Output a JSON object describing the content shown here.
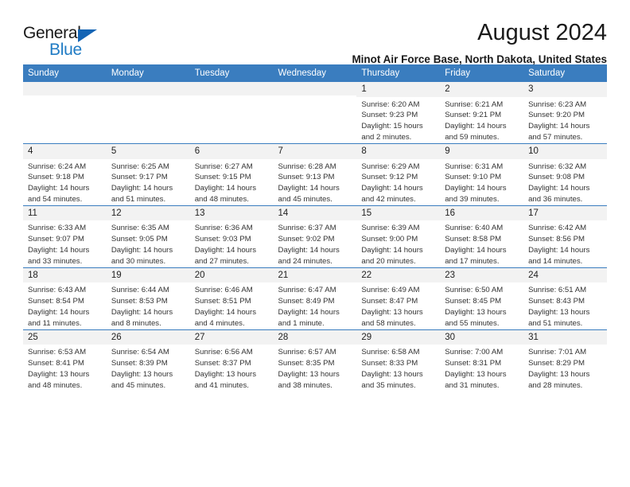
{
  "brand": {
    "line1": "General",
    "line2": "Blue",
    "triangle_color": "#1565b5",
    "blue_color": "#1f7bc4"
  },
  "header": {
    "title": "August 2024",
    "subtitle": "Minot Air Force Base, North Dakota, United States"
  },
  "theme": {
    "header_bg": "#3a7dbf",
    "daynum_bg": "#f2f2f2",
    "rule_color": "#3a7dbf"
  },
  "weekdays": [
    "Sunday",
    "Monday",
    "Tuesday",
    "Wednesday",
    "Thursday",
    "Friday",
    "Saturday"
  ],
  "weeks": [
    [
      {
        "day": "",
        "empty": true
      },
      {
        "day": "",
        "empty": true
      },
      {
        "day": "",
        "empty": true
      },
      {
        "day": "",
        "empty": true
      },
      {
        "day": "1",
        "sunrise": "Sunrise: 6:20 AM",
        "sunset": "Sunset: 9:23 PM",
        "daylight_1": "Daylight: 15 hours",
        "daylight_2": "and 2 minutes."
      },
      {
        "day": "2",
        "sunrise": "Sunrise: 6:21 AM",
        "sunset": "Sunset: 9:21 PM",
        "daylight_1": "Daylight: 14 hours",
        "daylight_2": "and 59 minutes."
      },
      {
        "day": "3",
        "sunrise": "Sunrise: 6:23 AM",
        "sunset": "Sunset: 9:20 PM",
        "daylight_1": "Daylight: 14 hours",
        "daylight_2": "and 57 minutes."
      }
    ],
    [
      {
        "day": "4",
        "sunrise": "Sunrise: 6:24 AM",
        "sunset": "Sunset: 9:18 PM",
        "daylight_1": "Daylight: 14 hours",
        "daylight_2": "and 54 minutes."
      },
      {
        "day": "5",
        "sunrise": "Sunrise: 6:25 AM",
        "sunset": "Sunset: 9:17 PM",
        "daylight_1": "Daylight: 14 hours",
        "daylight_2": "and 51 minutes."
      },
      {
        "day": "6",
        "sunrise": "Sunrise: 6:27 AM",
        "sunset": "Sunset: 9:15 PM",
        "daylight_1": "Daylight: 14 hours",
        "daylight_2": "and 48 minutes."
      },
      {
        "day": "7",
        "sunrise": "Sunrise: 6:28 AM",
        "sunset": "Sunset: 9:13 PM",
        "daylight_1": "Daylight: 14 hours",
        "daylight_2": "and 45 minutes."
      },
      {
        "day": "8",
        "sunrise": "Sunrise: 6:29 AM",
        "sunset": "Sunset: 9:12 PM",
        "daylight_1": "Daylight: 14 hours",
        "daylight_2": "and 42 minutes."
      },
      {
        "day": "9",
        "sunrise": "Sunrise: 6:31 AM",
        "sunset": "Sunset: 9:10 PM",
        "daylight_1": "Daylight: 14 hours",
        "daylight_2": "and 39 minutes."
      },
      {
        "day": "10",
        "sunrise": "Sunrise: 6:32 AM",
        "sunset": "Sunset: 9:08 PM",
        "daylight_1": "Daylight: 14 hours",
        "daylight_2": "and 36 minutes."
      }
    ],
    [
      {
        "day": "11",
        "sunrise": "Sunrise: 6:33 AM",
        "sunset": "Sunset: 9:07 PM",
        "daylight_1": "Daylight: 14 hours",
        "daylight_2": "and 33 minutes."
      },
      {
        "day": "12",
        "sunrise": "Sunrise: 6:35 AM",
        "sunset": "Sunset: 9:05 PM",
        "daylight_1": "Daylight: 14 hours",
        "daylight_2": "and 30 minutes."
      },
      {
        "day": "13",
        "sunrise": "Sunrise: 6:36 AM",
        "sunset": "Sunset: 9:03 PM",
        "daylight_1": "Daylight: 14 hours",
        "daylight_2": "and 27 minutes."
      },
      {
        "day": "14",
        "sunrise": "Sunrise: 6:37 AM",
        "sunset": "Sunset: 9:02 PM",
        "daylight_1": "Daylight: 14 hours",
        "daylight_2": "and 24 minutes."
      },
      {
        "day": "15",
        "sunrise": "Sunrise: 6:39 AM",
        "sunset": "Sunset: 9:00 PM",
        "daylight_1": "Daylight: 14 hours",
        "daylight_2": "and 20 minutes."
      },
      {
        "day": "16",
        "sunrise": "Sunrise: 6:40 AM",
        "sunset": "Sunset: 8:58 PM",
        "daylight_1": "Daylight: 14 hours",
        "daylight_2": "and 17 minutes."
      },
      {
        "day": "17",
        "sunrise": "Sunrise: 6:42 AM",
        "sunset": "Sunset: 8:56 PM",
        "daylight_1": "Daylight: 14 hours",
        "daylight_2": "and 14 minutes."
      }
    ],
    [
      {
        "day": "18",
        "sunrise": "Sunrise: 6:43 AM",
        "sunset": "Sunset: 8:54 PM",
        "daylight_1": "Daylight: 14 hours",
        "daylight_2": "and 11 minutes."
      },
      {
        "day": "19",
        "sunrise": "Sunrise: 6:44 AM",
        "sunset": "Sunset: 8:53 PM",
        "daylight_1": "Daylight: 14 hours",
        "daylight_2": "and 8 minutes."
      },
      {
        "day": "20",
        "sunrise": "Sunrise: 6:46 AM",
        "sunset": "Sunset: 8:51 PM",
        "daylight_1": "Daylight: 14 hours",
        "daylight_2": "and 4 minutes."
      },
      {
        "day": "21",
        "sunrise": "Sunrise: 6:47 AM",
        "sunset": "Sunset: 8:49 PM",
        "daylight_1": "Daylight: 14 hours",
        "daylight_2": "and 1 minute."
      },
      {
        "day": "22",
        "sunrise": "Sunrise: 6:49 AM",
        "sunset": "Sunset: 8:47 PM",
        "daylight_1": "Daylight: 13 hours",
        "daylight_2": "and 58 minutes."
      },
      {
        "day": "23",
        "sunrise": "Sunrise: 6:50 AM",
        "sunset": "Sunset: 8:45 PM",
        "daylight_1": "Daylight: 13 hours",
        "daylight_2": "and 55 minutes."
      },
      {
        "day": "24",
        "sunrise": "Sunrise: 6:51 AM",
        "sunset": "Sunset: 8:43 PM",
        "daylight_1": "Daylight: 13 hours",
        "daylight_2": "and 51 minutes."
      }
    ],
    [
      {
        "day": "25",
        "sunrise": "Sunrise: 6:53 AM",
        "sunset": "Sunset: 8:41 PM",
        "daylight_1": "Daylight: 13 hours",
        "daylight_2": "and 48 minutes."
      },
      {
        "day": "26",
        "sunrise": "Sunrise: 6:54 AM",
        "sunset": "Sunset: 8:39 PM",
        "daylight_1": "Daylight: 13 hours",
        "daylight_2": "and 45 minutes."
      },
      {
        "day": "27",
        "sunrise": "Sunrise: 6:56 AM",
        "sunset": "Sunset: 8:37 PM",
        "daylight_1": "Daylight: 13 hours",
        "daylight_2": "and 41 minutes."
      },
      {
        "day": "28",
        "sunrise": "Sunrise: 6:57 AM",
        "sunset": "Sunset: 8:35 PM",
        "daylight_1": "Daylight: 13 hours",
        "daylight_2": "and 38 minutes."
      },
      {
        "day": "29",
        "sunrise": "Sunrise: 6:58 AM",
        "sunset": "Sunset: 8:33 PM",
        "daylight_1": "Daylight: 13 hours",
        "daylight_2": "and 35 minutes."
      },
      {
        "day": "30",
        "sunrise": "Sunrise: 7:00 AM",
        "sunset": "Sunset: 8:31 PM",
        "daylight_1": "Daylight: 13 hours",
        "daylight_2": "and 31 minutes."
      },
      {
        "day": "31",
        "sunrise": "Sunrise: 7:01 AM",
        "sunset": "Sunset: 8:29 PM",
        "daylight_1": "Daylight: 13 hours",
        "daylight_2": "and 28 minutes."
      }
    ]
  ]
}
